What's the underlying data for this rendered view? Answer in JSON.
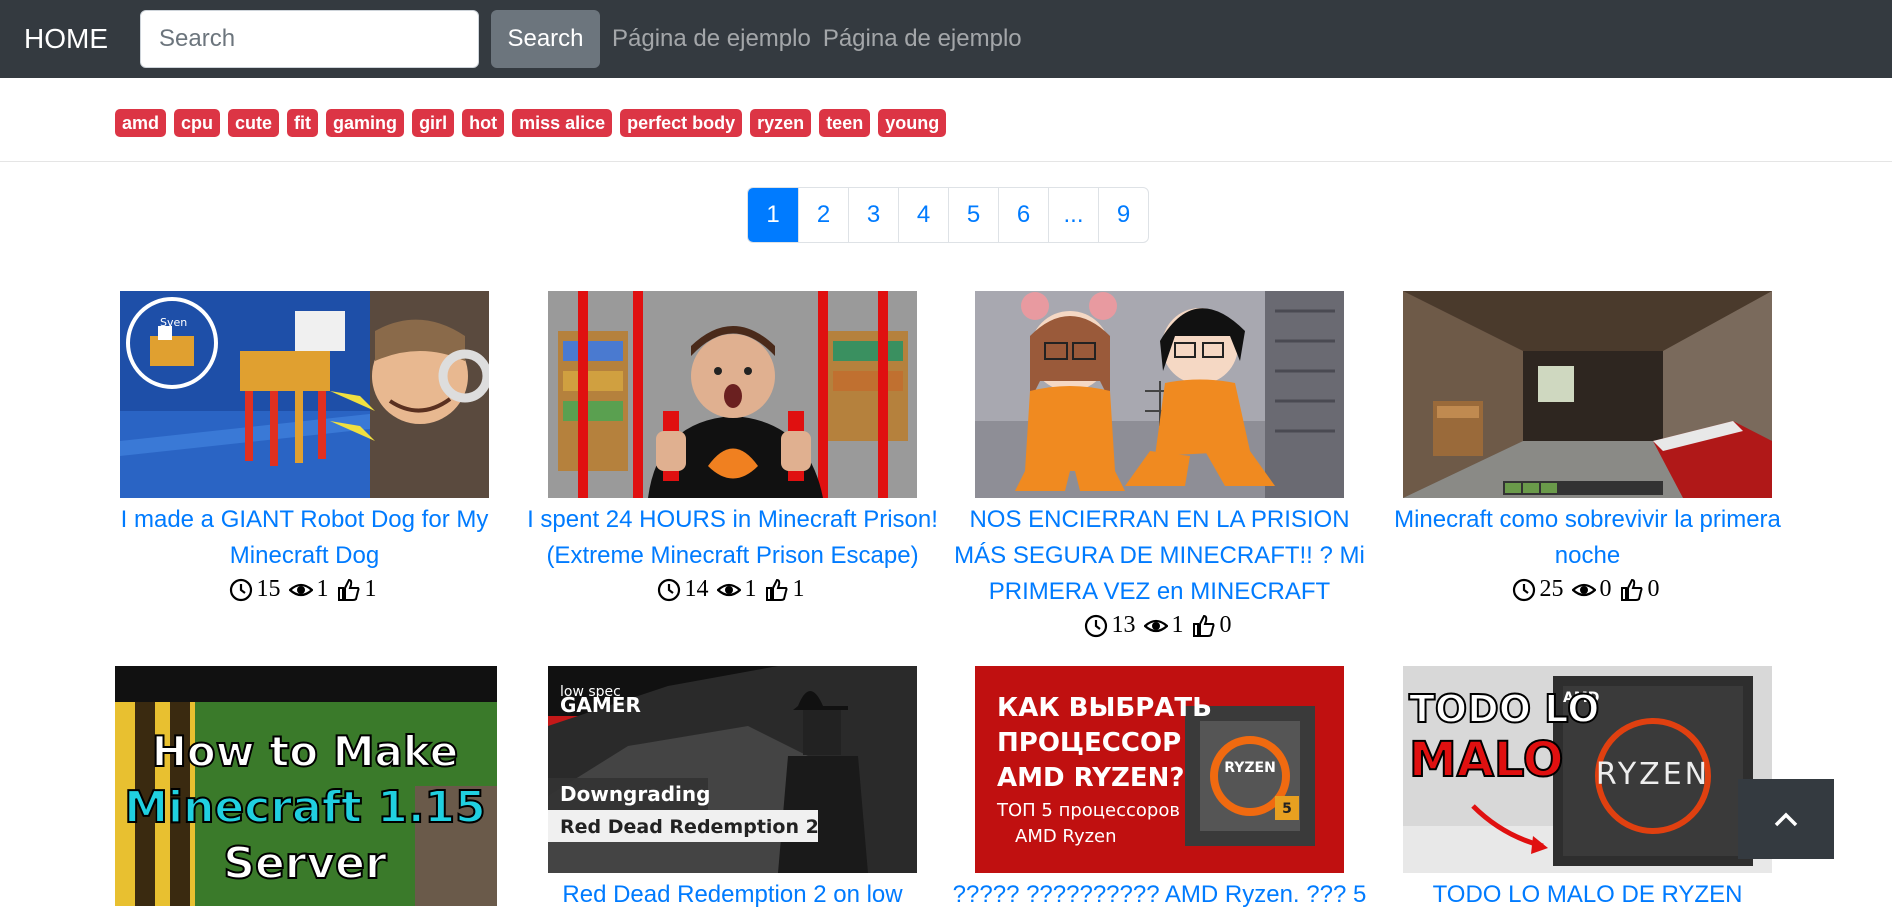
{
  "navbar": {
    "brand": "HOME",
    "search_placeholder": "Search",
    "search_button": "Search",
    "links": [
      "Página de ejemplo",
      "Página de ejemplo"
    ]
  },
  "tags": [
    "amd",
    "cpu",
    "cute",
    "fit",
    "gaming",
    "girl",
    "hot",
    "miss alice",
    "perfect body",
    "ryzen",
    "teen",
    "young"
  ],
  "pagination": [
    "1",
    "2",
    "3",
    "4",
    "5",
    "6",
    "...",
    "9"
  ],
  "pagination_active": "1",
  "videos": [
    {
      "title": "I made a GIANT Robot Dog for My Minecraft Dog",
      "duration": "15",
      "views": "1",
      "likes": "1"
    },
    {
      "title": "I spent 24 HOURS in Minecraft Prison! (Extreme Minecraft Prison Escape)",
      "duration": "14",
      "views": "1",
      "likes": "1"
    },
    {
      "title": "NOS ENCIERRAN EN LA PRISION MÁS SEGURA DE MINECRAFT!! ? Mi PRIMERA VEZ en MINECRAFT",
      "duration": "13",
      "views": "1",
      "likes": "0"
    },
    {
      "title": "Minecraft como sobrevivir la primera noche",
      "duration": "25",
      "views": "0",
      "likes": "0"
    },
    {
      "title": ""
    },
    {
      "title": "Red Dead Redemption 2 on low"
    },
    {
      "title": "????? ?????????? AMD Ryzen. ??? 5"
    },
    {
      "title": "TODO LO MALO DE RYZEN"
    }
  ],
  "thumb_texts": {
    "v1_label": "Sven",
    "v5_line1": "How to Make",
    "v5_line2": "Minecraft 1.15",
    "v5_line3": "Server",
    "v6_brand_top": "low spec",
    "v6_brand": "GAMER",
    "v6_line1": "Downgrading",
    "v6_line2": "Red Dead Redemption 2",
    "v7_line1": "КАК ВЫБРАТЬ",
    "v7_line2": "ПРОЦЕССОР",
    "v7_line3": "AMD RYZEN?",
    "v7_line4": "ТОП 5 процессоров",
    "v7_line5": "AMD Ryzen",
    "v7_box": "RYZEN",
    "v7_box_num": "5",
    "v8_line1": "TODO LO",
    "v8_line2": "MALO",
    "v8_brand": "AMD",
    "v8_box": "RYZEN"
  },
  "colors": {
    "navbar": "#343a40",
    "tag": "#dc3545",
    "link": "#007bff",
    "secondary": "#6c757d"
  }
}
